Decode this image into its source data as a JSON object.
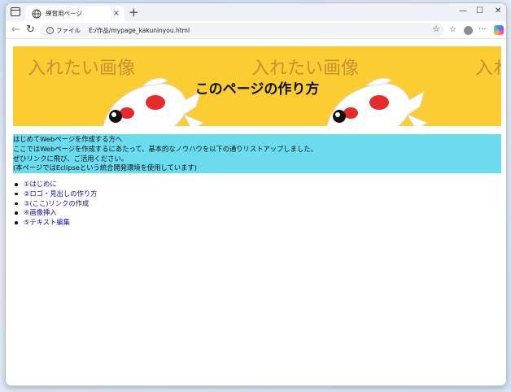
{
  "tab": {
    "title": "練習用ページ",
    "close": "×",
    "new": "+"
  },
  "window_controls": {
    "minimize": "—",
    "maximize": "☐",
    "close": "✕"
  },
  "toolbar": {
    "back": "←",
    "reload": "↻",
    "address_label": "ファイル",
    "address_path": "E:/作品/mypage_kakuninyou.html",
    "favorite": "☆",
    "collections": "☆",
    "more": "···"
  },
  "banner": {
    "deco_text": "入れたい画像",
    "title": "このページの作り方",
    "bg_color": "#fccd33"
  },
  "intro": {
    "bg_color": "#6bdcee",
    "lines": [
      "はじめてWebページを作成する方へ",
      "ここではWebページを作成するにあたって、基本的なノウハウを以下の通りリストアップしました。",
      "ぜひリンクに飛び、ご活用ください。",
      "(本ページではEclipseという統合開発環境を使用しています)"
    ]
  },
  "menu": [
    "①はじめに",
    "②ロゴ・見出しの作り方",
    "③(ここ)リンクの作成",
    "④画像挿入",
    "⑤テキスト編集"
  ],
  "icons": {
    "tab_actions": "tab-actions-icon",
    "globe": "globe-icon",
    "info": "info-icon",
    "profile": "avatar",
    "copilot": "copilot-icon"
  }
}
